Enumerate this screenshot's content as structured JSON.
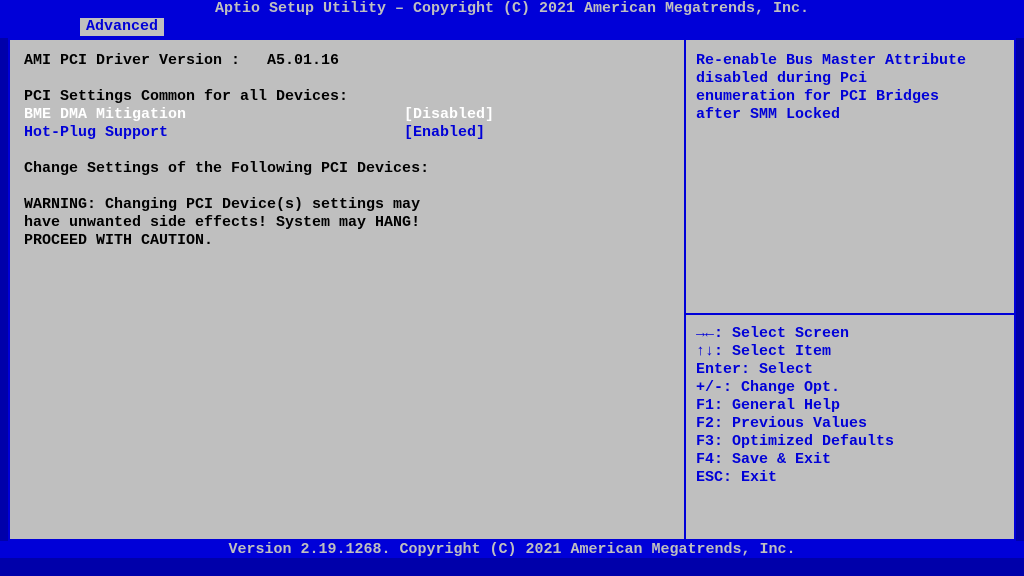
{
  "header": "Aptio Setup Utility – Copyright (C) 2021 American Megatrends, Inc.",
  "tab": "Advanced",
  "left": {
    "driver_label": "AMI PCI Driver Version :   ",
    "driver_value": "A5.01.16",
    "common_heading": "PCI Settings Common for all Devices:",
    "bme_label": "BME DMA Mitigation",
    "bme_value": "[Disabled]",
    "hot_label": "Hot-Plug Support",
    "hot_value": "[Enabled]",
    "change_heading": "Change Settings of the Following PCI Devices:",
    "warn1": "WARNING: Changing PCI Device(s) settings may",
    "warn2": "have unwanted side effects! System may HANG!",
    "warn3": "PROCEED WITH CAUTION."
  },
  "right": {
    "help1": "Re-enable Bus Master Attribute",
    "help2": "disabled during Pci",
    "help3": "enumeration for PCI Bridges",
    "help4": "after SMM Locked",
    "k1": "→←: Select Screen",
    "k2": "↑↓: Select Item",
    "k3": "Enter: Select",
    "k4": "+/-: Change Opt.",
    "k5": "F1: General Help",
    "k6": "F2: Previous Values",
    "k7": "F3: Optimized Defaults",
    "k8": "F4: Save & Exit",
    "k9": "ESC: Exit"
  },
  "footer": "Version 2.19.1268. Copyright (C) 2021 American Megatrends, Inc."
}
